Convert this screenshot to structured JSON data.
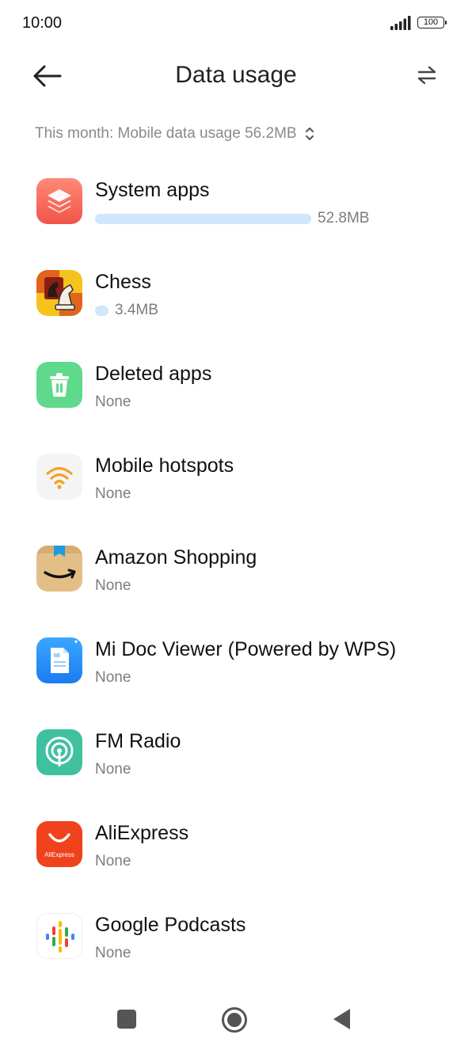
{
  "status_bar": {
    "time": "10:00",
    "battery": "100"
  },
  "header": {
    "title": "Data usage"
  },
  "period": {
    "label": "This month: Mobile data usage 56.2MB"
  },
  "apps": [
    {
      "name": "System apps",
      "usage": "52.8MB",
      "usage_fraction": 0.94,
      "icon": "system-apps-icon"
    },
    {
      "name": "Chess",
      "usage": "3.4MB",
      "usage_fraction": 0.06,
      "icon": "chess-icon"
    },
    {
      "name": "Deleted apps",
      "usage": "None",
      "icon": "trash-icon"
    },
    {
      "name": "Mobile hotspots",
      "usage": "None",
      "icon": "wifi-hotspot-icon"
    },
    {
      "name": "Amazon Shopping",
      "usage": "None",
      "icon": "amazon-icon"
    },
    {
      "name": "Mi Doc Viewer (Powered by WPS)",
      "usage": "None",
      "icon": "doc-viewer-icon"
    },
    {
      "name": "FM Radio",
      "usage": "None",
      "icon": "radio-icon"
    },
    {
      "name": "AliExpress",
      "usage": "None",
      "icon": "aliexpress-icon"
    },
    {
      "name": "Google Podcasts",
      "usage": "None",
      "icon": "podcasts-icon"
    }
  ],
  "icon_labels": {
    "mi_doc": "MI",
    "aliexpress": "AliExpress"
  },
  "colors": {
    "usage_bar": "#cfe6fb",
    "secondary_text": "#7d7d7d"
  }
}
